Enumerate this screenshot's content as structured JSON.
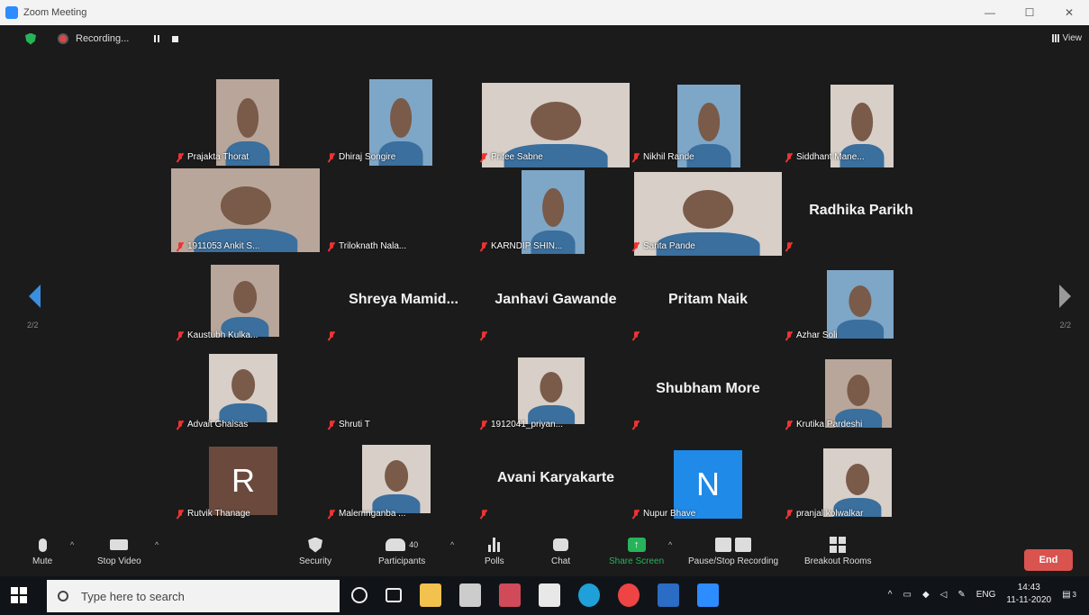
{
  "window": {
    "title": "Zoom Meeting",
    "controls": [
      "—",
      "☐",
      "✕"
    ]
  },
  "topbar": {
    "recording_label": "Recording...",
    "view_label": "View"
  },
  "pagination": {
    "left": "2/2",
    "right": "2/2"
  },
  "tiles": [
    {
      "name": "Prajakta Thorat"
    },
    {
      "name": "Dhiraj Songire"
    },
    {
      "name": "Pritee Sabne"
    },
    {
      "name": "Nikhil Rande"
    },
    {
      "name": "Siddhant Mane..."
    },
    {
      "name": "1911053 Ankit S..."
    },
    {
      "name": "Triloknath Nala..."
    },
    {
      "name": "KARNDIP SHIN..."
    },
    {
      "name": "Sarita Pande"
    },
    {
      "name": "Radhika Parikh",
      "big": "Radhika Parikh"
    },
    {
      "name": "Kaustubh Kulka..."
    },
    {
      "name": "",
      "big": "Shreya  Mamid..."
    },
    {
      "name": "",
      "big": "Janhavi Gawande"
    },
    {
      "name": "",
      "big": "Pritam Naik"
    },
    {
      "name": "Azhar Soli"
    },
    {
      "name": "Advait Ghaisas"
    },
    {
      "name": "Shruti T"
    },
    {
      "name": "1912041_priyan..."
    },
    {
      "name": "",
      "big": "Shubham More"
    },
    {
      "name": "Krutika Pardeshi"
    },
    {
      "name": "Rutvik Thanage",
      "letter": "R"
    },
    {
      "name": "Malemnganba ..."
    },
    {
      "name": "",
      "big": "Avani Karyakarte"
    },
    {
      "name": "Nupur Bhave",
      "letter": "N"
    },
    {
      "name": "pranjal kolwalkar"
    }
  ],
  "toolbar": {
    "mute": "Mute",
    "stop_video": "Stop Video",
    "security": "Security",
    "participants": "Participants",
    "participants_count": "40",
    "polls": "Polls",
    "chat": "Chat",
    "share_screen": "Share Screen",
    "pause_stop_recording": "Pause/Stop Recording",
    "breakout_rooms": "Breakout Rooms",
    "end": "End"
  },
  "taskbar": {
    "search_placeholder": "Type here to search",
    "lang": "ENG",
    "time": "14:43",
    "date": "11-11-2020",
    "notifications": "3"
  },
  "colors": {
    "accent": "#2d8cff",
    "end": "#d9534f",
    "share": "#27b35a"
  }
}
